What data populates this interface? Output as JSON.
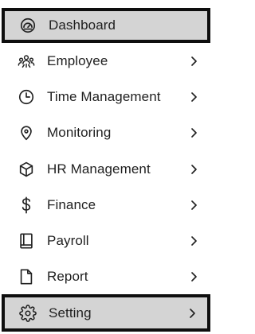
{
  "sidebar": {
    "items": [
      {
        "label": "Dashboard",
        "icon": "gauge-icon",
        "has_chevron": false,
        "highlighted": true
      },
      {
        "label": "Employee",
        "icon": "users-icon",
        "has_chevron": true,
        "highlighted": false
      },
      {
        "label": "Time Management",
        "icon": "clock-icon",
        "has_chevron": true,
        "highlighted": false
      },
      {
        "label": "Monitoring",
        "icon": "map-pin-icon",
        "has_chevron": true,
        "highlighted": false
      },
      {
        "label": "HR Management",
        "icon": "cube-icon",
        "has_chevron": true,
        "highlighted": false
      },
      {
        "label": "Finance",
        "icon": "dollar-icon",
        "has_chevron": true,
        "highlighted": false
      },
      {
        "label": "Payroll",
        "icon": "book-icon",
        "has_chevron": true,
        "highlighted": false
      },
      {
        "label": "Report",
        "icon": "file-icon",
        "has_chevron": true,
        "highlighted": false
      },
      {
        "label": "Setting",
        "icon": "gear-icon",
        "has_chevron": true,
        "highlighted": true
      }
    ],
    "chevron_glyph": ">",
    "colors": {
      "highlight_background": "#d4d4d4",
      "highlight_border": "#0e0e0e",
      "text": "#1f1f1f"
    }
  }
}
